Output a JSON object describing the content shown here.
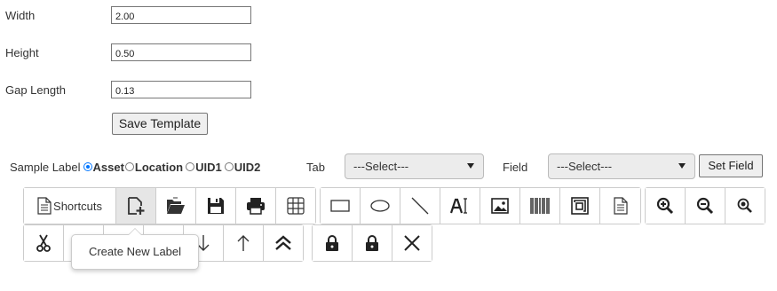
{
  "form": {
    "width_label": "Width",
    "width_value": "2.00",
    "height_label": "Height",
    "height_value": "0.50",
    "gap_label": "Gap Length",
    "gap_value": "0.13",
    "save_label": "Save Template"
  },
  "sample": {
    "label": "Sample Label",
    "options": [
      "Asset",
      "Location",
      "UID1",
      "UID2"
    ],
    "selected": "Asset",
    "tab_label": "Tab",
    "tab_select": "---Select---",
    "field_label": "Field",
    "field_select": "---Select---",
    "set_field_label": "Set Field"
  },
  "toolbar": {
    "shortcuts_label": "Shortcuts",
    "accent": "#0075ff",
    "tooltip": "Create New Label"
  }
}
